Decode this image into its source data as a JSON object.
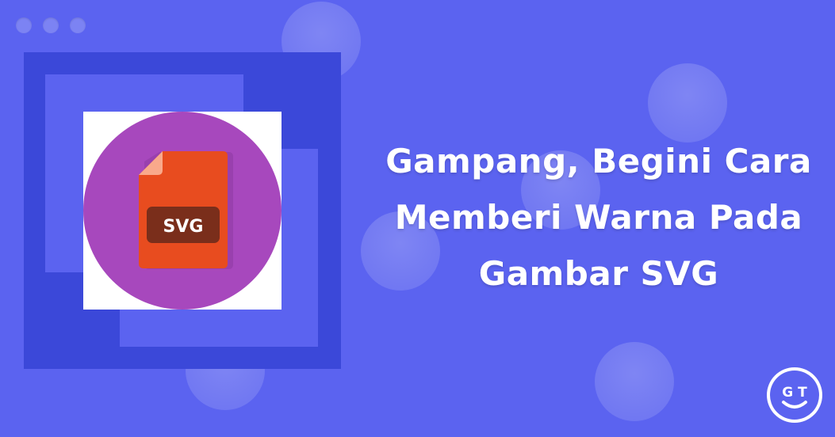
{
  "window_controls": {
    "dots": [
      "dot-1",
      "dot-2",
      "dot-3"
    ]
  },
  "icon": {
    "name": "svg-file-icon",
    "label": "SVG",
    "colors": {
      "circle": "#a748bd",
      "file": "#e84c1f",
      "file_fold": "#f9a98b",
      "label_box": "#7a2e1b",
      "label_text": "#ffffff"
    }
  },
  "headline": {
    "line1": "Gampang, Begini Cara",
    "line2": "Memberi Warna Pada",
    "line3": "Gambar SVG"
  },
  "brand": {
    "logo_text": "G T",
    "logo_name": "gt-logo-icon"
  },
  "colors": {
    "background": "#5b63f0",
    "frame": "#3b48d9",
    "text": "#ffffff"
  }
}
